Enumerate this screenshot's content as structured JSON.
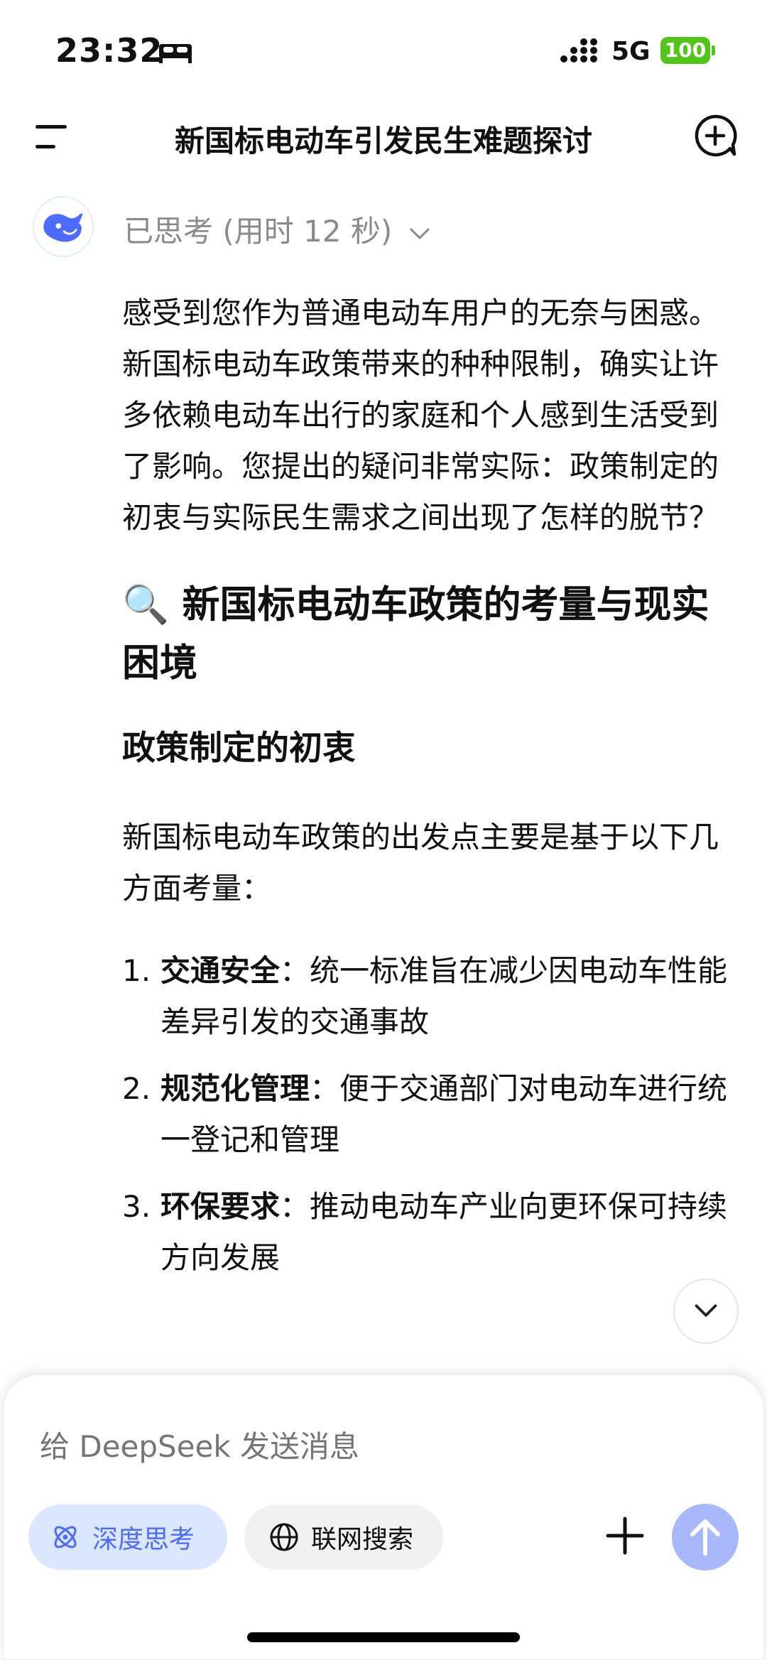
{
  "status": {
    "time": "23:32",
    "network": "5G",
    "battery": "100"
  },
  "nav": {
    "title": "新国标电动车引发民生难题探讨",
    "menu_icon": "menu-icon",
    "new_chat_icon": "new-chat-icon"
  },
  "thinking": {
    "label": "已思考 (用时 12 秒)"
  },
  "message": {
    "intro": "感受到您作为普通电动车用户的无奈与困惑。新国标电动车政策带来的种种限制，确实让许多依赖电动车出行的家庭和个人感到生活受到了影响。您提出的疑问非常实际：政策制定的初衷与实际民生需求之间出现了怎样的脱节？",
    "h2": "🔍 新国标电动车政策的考量与现实困境",
    "h3": "政策制定的初衷",
    "p2": "新国标电动车政策的出发点主要是基于以下几方面考量：",
    "list": [
      {
        "num": "1.",
        "bold": "交通安全",
        "sep": "：",
        "text": "统一标准旨在减少因电动车性能差异引发的交通事故"
      },
      {
        "num": "2.",
        "bold": "规范化管理",
        "sep": "：",
        "text": "便于交通部门对电动车进行统一登记和管理"
      },
      {
        "num": "3.",
        "bold": "环保要求",
        "sep": "：",
        "text": "推动电动车产业向更环保可持续方向发展"
      }
    ]
  },
  "composer": {
    "placeholder": "给 DeepSeek 发送消息",
    "deep_think": "深度思考",
    "web_search": "联网搜索"
  },
  "colors": {
    "accent": "#4d6bfe",
    "battery": "#52c41a",
    "send": "#a8b8fb"
  }
}
